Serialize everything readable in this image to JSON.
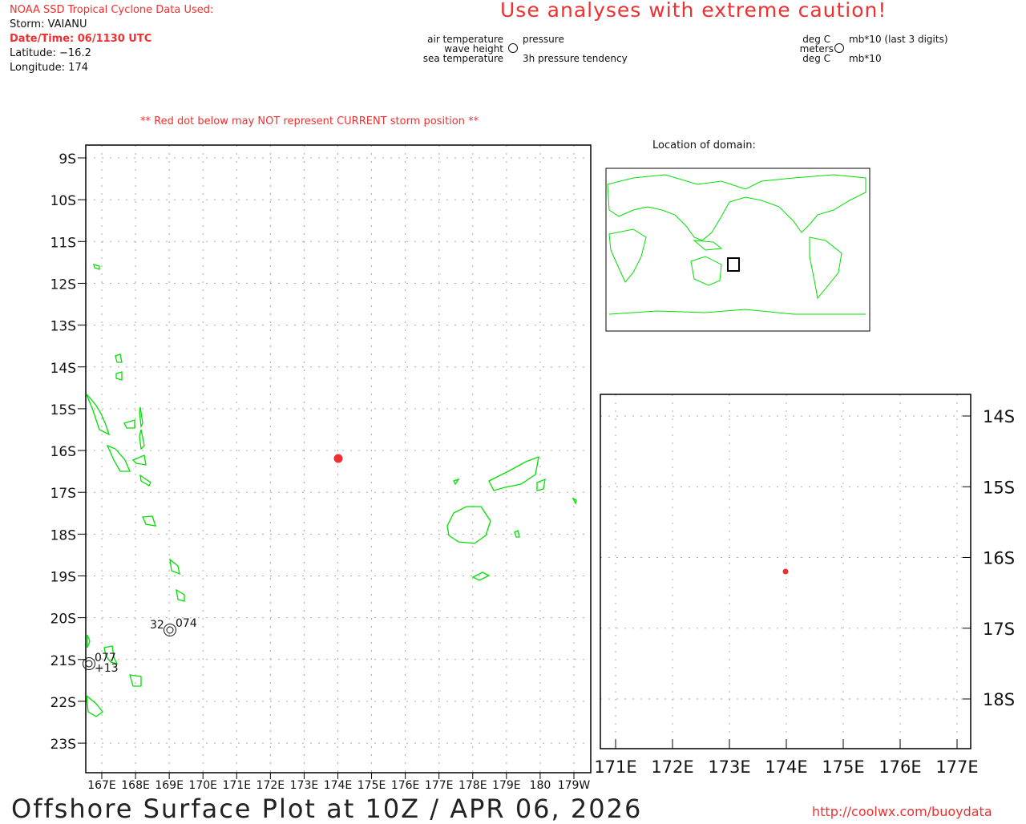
{
  "header": {
    "source": "NOAA SSD Tropical Cyclone Data Used:",
    "storm": "Storm: VAIANU",
    "datetime": "Date/Time: 06/1130 UTC",
    "latitude": "Latitude: −16.2",
    "longitude": "Longitude: 174",
    "warning": "Use analyses with extreme caution!"
  },
  "legend": {
    "left": {
      "tl": "air temperature",
      "ml": "wave height",
      "bl": "sea temperature",
      "tr": "pressure",
      "br": "3h pressure tendency"
    },
    "right": {
      "tl": "deg C",
      "ml": "meters",
      "bl": "deg C",
      "tr": "mb*10 (last 3 digits)",
      "br": "mb*10"
    }
  },
  "note": "** Red dot below may NOT represent CURRENT storm position **",
  "inset_title": "Location of domain:",
  "main_map": {
    "lat_labels": [
      "9S",
      "10S",
      "11S",
      "12S",
      "13S",
      "14S",
      "15S",
      "16S",
      "17S",
      "18S",
      "19S",
      "20S",
      "21S",
      "22S",
      "23S"
    ],
    "lon_labels": [
      "167E",
      "168E",
      "169E",
      "170E",
      "171E",
      "172E",
      "173E",
      "174E",
      "175E",
      "176E",
      "177E",
      "178E",
      "179E",
      "180",
      "179W"
    ],
    "storm": {
      "lat": -16.2,
      "lon": 174
    },
    "stations": [
      {
        "air": "32",
        "pressure": "074"
      },
      {
        "pressure": "077",
        "tendency": "+13"
      }
    ]
  },
  "zoom_map": {
    "lat_labels": [
      "14S",
      "15S",
      "16S",
      "17S",
      "18S"
    ],
    "lon_labels": [
      "171E",
      "172E",
      "173E",
      "174E",
      "175E",
      "176E",
      "177E"
    ]
  },
  "footer": {
    "title": "Offshore Surface Plot at 10Z / APR 06, 2026",
    "url": "http://coolwx.com/buoydata"
  },
  "colors": {
    "land": "#00e000",
    "storm": "#f03030"
  }
}
